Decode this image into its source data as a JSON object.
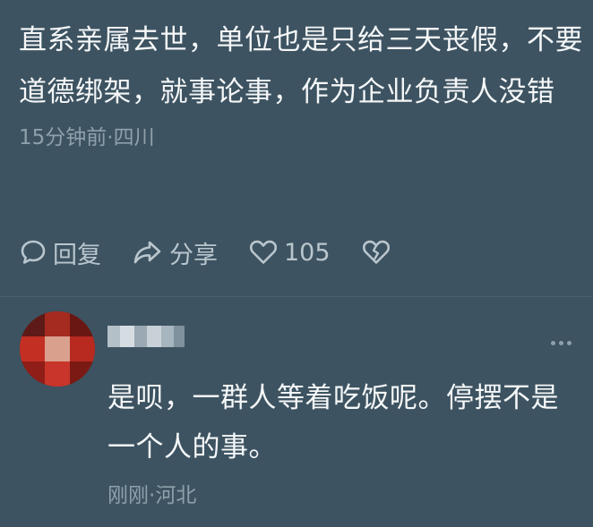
{
  "comment": {
    "text": "直系亲属去世，单位也是只给三天丧假，不要道德绑架，就事论事，作为企业负责人没错",
    "time": "15分钟前",
    "separator": "·",
    "location": "四川"
  },
  "actions": {
    "reply_label": "回复",
    "share_label": "分享",
    "like_count": "105",
    "icons": {
      "reply": "chat-bubble-icon",
      "share": "share-arrow-icon",
      "like": "heart-icon",
      "dislike": "broken-heart-icon"
    }
  },
  "reply": {
    "avatar_icon": "avatar-blurred",
    "username_icon": "blurred-username",
    "more_icon": "more-dots-icon",
    "text": "是呗，一群人等着吃饭呢。停摆不是一个人的事。",
    "time": "刚刚",
    "separator": "·",
    "location": "河北"
  },
  "colors": {
    "background": "#3d5361",
    "primary_text": "#f5f7f8",
    "secondary_text": "#8ea0ab",
    "action_text": "#b9c6ce"
  }
}
